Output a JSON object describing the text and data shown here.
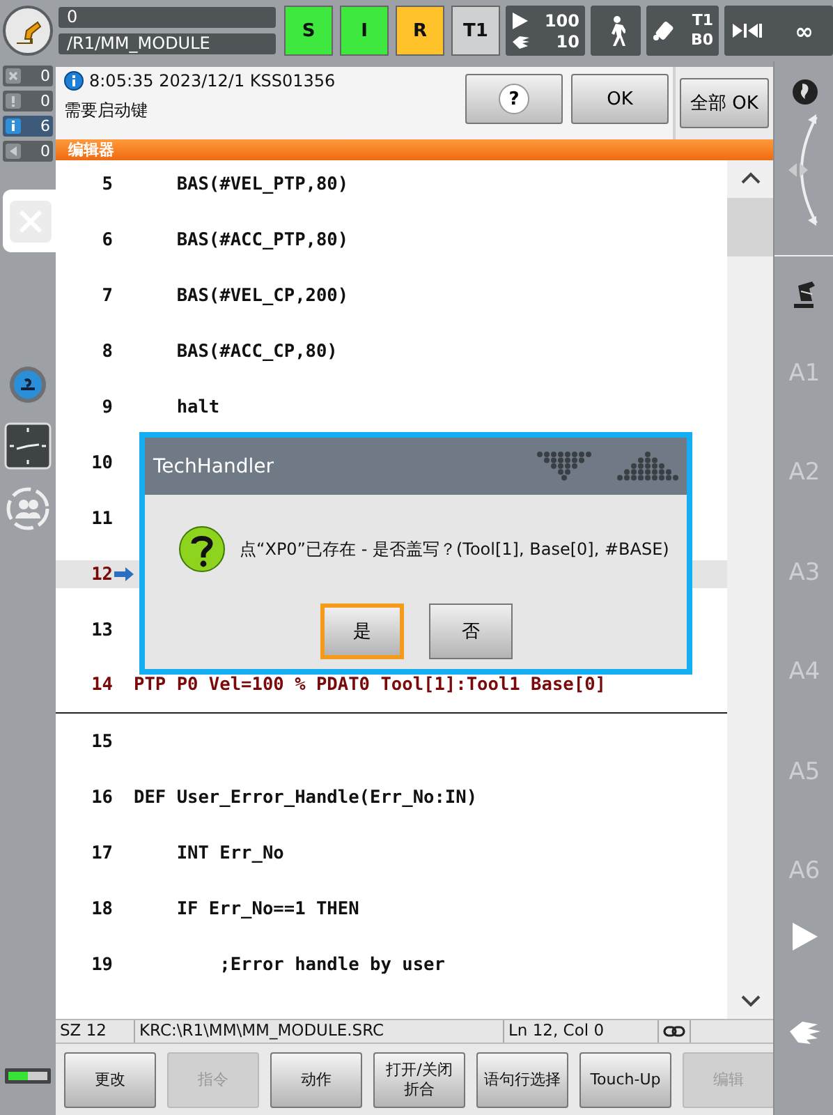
{
  "header": {
    "program_status": "0",
    "program_path": "/R1/MM_MODULE",
    "status_keys": [
      {
        "label": "S",
        "color": "#3ee83e"
      },
      {
        "label": "I",
        "color": "#3ee83e"
      },
      {
        "label": "R",
        "color": "#ffc22a"
      },
      {
        "label": "T1",
        "color": "#cfd0d1"
      }
    ],
    "override": {
      "program": "100",
      "jog": "10"
    },
    "tool_base": {
      "tool": "T1",
      "base": "B0"
    },
    "increment": "∞"
  },
  "message_counters": [
    {
      "kind": "acknowledge",
      "count": "0",
      "selected": false
    },
    {
      "kind": "warning",
      "count": "0",
      "selected": false
    },
    {
      "kind": "info",
      "count": "6",
      "selected": true
    },
    {
      "kind": "wait",
      "count": "0",
      "selected": false
    }
  ],
  "message": {
    "header": "8:05:35 2023/12/1 KSS01356",
    "text": "需要启动键",
    "buttons": [
      "?",
      "OK"
    ],
    "all_ok": "全部 OK"
  },
  "editor": {
    "title": "编辑器",
    "lines": [
      {
        "number": "5",
        "text": "    BAS(#VEL_PTP,80)",
        "selected": false,
        "marked": false,
        "divider_after": false
      },
      {
        "number": "6",
        "text": "    BAS(#ACC_PTP,80)",
        "selected": false,
        "marked": false,
        "divider_after": false
      },
      {
        "number": "7",
        "text": "    BAS(#VEL_CP,200)",
        "selected": false,
        "marked": false,
        "divider_after": false
      },
      {
        "number": "8",
        "text": "    BAS(#ACC_CP,80)",
        "selected": false,
        "marked": false,
        "divider_after": false
      },
      {
        "number": "9",
        "text": "    halt",
        "selected": false,
        "marked": false,
        "divider_after": false
      },
      {
        "number": "10",
        "selected": false,
        "marked": false,
        "divider_after": false
      },
      {
        "number": "11",
        "selected": false,
        "marked": false,
        "divider_after": false
      },
      {
        "number": "12",
        "selected": true,
        "marked": true,
        "divider_after": false
      },
      {
        "number": "13",
        "selected": false,
        "marked": false,
        "divider_after": false
      },
      {
        "number": "14",
        "text": "PTP P0 Vel=100 % PDAT0 Tool[1]:Tool1 Base[0]",
        "selected": false,
        "marked": true,
        "divider_after": true
      },
      {
        "number": "15",
        "selected": false,
        "marked": false,
        "divider_after": false
      },
      {
        "number": "16",
        "text": "DEF User_Error_Handle(Err_No:IN)",
        "selected": false,
        "marked": false,
        "divider_after": false
      },
      {
        "number": "17",
        "text": "    INT Err_No",
        "selected": false,
        "marked": false,
        "divider_after": false
      },
      {
        "number": "18",
        "text": "    IF Err_No==1 THEN",
        "selected": false,
        "marked": false,
        "divider_after": false
      },
      {
        "number": "19",
        "text": "        ;Error handle by user",
        "selected": false,
        "marked": false,
        "divider_after": false
      }
    ]
  },
  "status_bar": {
    "row": "SZ 12",
    "file": "KRC:\\R1\\MM\\MM_MODULE.SRC",
    "position": "Ln 12, Col 0"
  },
  "softkeys": [
    {
      "label": "更改",
      "disabled": false
    },
    {
      "label": "指令",
      "disabled": true
    },
    {
      "label": "动作",
      "disabled": false
    },
    {
      "label": "打开/关闭折合",
      "disabled": false
    },
    {
      "label": "语句行选择",
      "disabled": false
    },
    {
      "label": "Touch-Up",
      "disabled": false
    },
    {
      "label": "编辑",
      "disabled": true
    }
  ],
  "axes": [
    "A1",
    "A2",
    "A3",
    "A4",
    "A5",
    "A6"
  ],
  "dialog": {
    "title": "TechHandler",
    "message": "点“XP0”已存在 - 是否盖写？(Tool[1], Base[0], #BASE)",
    "buttons": [
      {
        "label": "是",
        "selected": true
      },
      {
        "label": "否",
        "selected": false
      }
    ]
  }
}
